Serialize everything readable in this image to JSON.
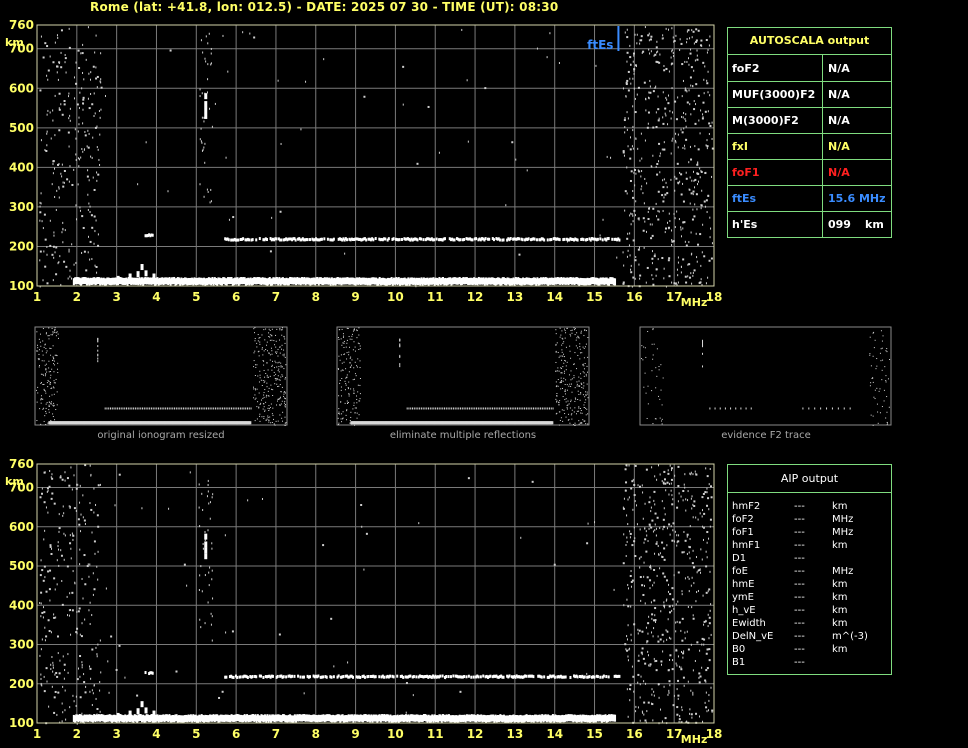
{
  "header": {
    "title": "Rome (lat: +41.8, lon: 012.5) - DATE: 2025 07 30 - TIME (UT): 08:30"
  },
  "colors": {
    "axis_text": "#ffff66",
    "frame": "#d4d4aa",
    "grid": "#7a7a7a",
    "trace": "#ffffff",
    "table_border": "#7fdc7f",
    "foF1_red": "#ff2020",
    "ftEs_blue": "#3a8cff"
  },
  "autoscala": {
    "title": "AUTOSCALA output",
    "rows": [
      {
        "label": "foF2",
        "value": "N/A",
        "unit": "",
        "color": "#ffffff"
      },
      {
        "label": "MUF(3000)F2",
        "value": "N/A",
        "unit": "",
        "color": "#ffffff"
      },
      {
        "label": "M(3000)F2",
        "value": "N/A",
        "unit": "",
        "color": "#ffffff"
      },
      {
        "label": "fxI",
        "value": "N/A",
        "unit": "",
        "color": "#ffff66"
      },
      {
        "label": "foF1",
        "value": "N/A",
        "unit": "",
        "color": "#ff2020"
      },
      {
        "label": "ftEs",
        "value": "15.6 MHz",
        "unit": "",
        "color": "#3a8cff"
      },
      {
        "label": "h'Es",
        "value": "099",
        "unit": "km",
        "color": "#ffffff"
      }
    ]
  },
  "aip": {
    "title": "AIP output",
    "rows": [
      {
        "label": "hmF2",
        "value": "---",
        "unit": "km"
      },
      {
        "label": "foF2",
        "value": "---",
        "unit": "MHz"
      },
      {
        "label": "foF1",
        "value": "---",
        "unit": "MHz"
      },
      {
        "label": "hmF1",
        "value": "---",
        "unit": "km"
      },
      {
        "label": "D1",
        "value": "---",
        "unit": ""
      },
      {
        "label": "foE",
        "value": "---",
        "unit": "MHz"
      },
      {
        "label": "hmE",
        "value": "---",
        "unit": "km"
      },
      {
        "label": "ymE",
        "value": "---",
        "unit": "km"
      },
      {
        "label": "h_vE",
        "value": "---",
        "unit": "km"
      },
      {
        "label": "Ewidth",
        "value": "---",
        "unit": "km"
      },
      {
        "label": "DelN_vE",
        "value": "---",
        "unit": "m^(-3)"
      },
      {
        "label": "B0",
        "value": "---",
        "unit": "km"
      },
      {
        "label": "B1",
        "value": "---",
        "unit": ""
      }
    ]
  },
  "thumbnails": [
    {
      "caption": "original ionogram resized"
    },
    {
      "caption": "eliminate multiple reflections"
    },
    {
      "caption": "evidence F2 trace"
    }
  ],
  "chart_data": [
    {
      "type": "scatter",
      "name": "autoscala-ionogram",
      "xlabel": "MHz",
      "ylabel": "km",
      "xlim": [
        1,
        18
      ],
      "ylim": [
        100,
        760
      ],
      "x_ticks": [
        1,
        2,
        3,
        4,
        5,
        6,
        7,
        8,
        9,
        10,
        11,
        12,
        13,
        14,
        15,
        16,
        17,
        18
      ],
      "y_ticks": [
        100,
        200,
        300,
        400,
        500,
        600,
        700,
        760
      ],
      "grid": true,
      "annotations": [
        {
          "text": "ftEs",
          "x": 15.6,
          "color": "#3a8cff"
        }
      ],
      "traces": [
        {
          "name": "Es",
          "x_range": [
            1.9,
            15.5
          ],
          "height_km": 112
        },
        {
          "name": "Es-cusp",
          "x": [
            3.0,
            3.3,
            3.5,
            3.6,
            3.7,
            3.9
          ],
          "y": [
            118,
            124,
            130,
            148,
            132,
            124
          ]
        },
        {
          "name": "Es-2nd",
          "x_range": [
            5.7,
            15.6
          ],
          "height_km": 218
        },
        {
          "name": "Es-2nd-fragment",
          "x_range": [
            3.7,
            3.9
          ],
          "height_km": 228
        },
        {
          "name": "noise-column",
          "x": [
            5.2,
            5.2,
            5.2,
            5.2
          ],
          "y": [
            530,
            545,
            560,
            580
          ]
        }
      ]
    },
    {
      "type": "scatter",
      "name": "aip-ionogram",
      "xlabel": "MHz",
      "ylabel": "km",
      "xlim": [
        1,
        18
      ],
      "ylim": [
        100,
        760
      ],
      "x_ticks": [
        1,
        2,
        3,
        4,
        5,
        6,
        7,
        8,
        9,
        10,
        11,
        12,
        13,
        14,
        15,
        16,
        17,
        18
      ],
      "y_ticks": [
        100,
        200,
        300,
        400,
        500,
        600,
        700,
        760
      ],
      "grid": true,
      "traces": [
        {
          "name": "Es",
          "x_range": [
            1.9,
            15.5
          ],
          "height_km": 112
        },
        {
          "name": "Es-cusp",
          "x": [
            3.0,
            3.3,
            3.5,
            3.6,
            3.7,
            3.9
          ],
          "y": [
            118,
            124,
            130,
            148,
            132,
            124
          ]
        },
        {
          "name": "Es-2nd",
          "x_range": [
            5.7,
            15.6
          ],
          "height_km": 218
        },
        {
          "name": "Es-2nd-fragment",
          "x_range": [
            3.7,
            3.9
          ],
          "height_km": 228
        },
        {
          "name": "noise-column",
          "x": [
            5.2,
            5.2,
            5.2,
            5.2
          ],
          "y": [
            525,
            540,
            555,
            575
          ]
        }
      ]
    }
  ]
}
